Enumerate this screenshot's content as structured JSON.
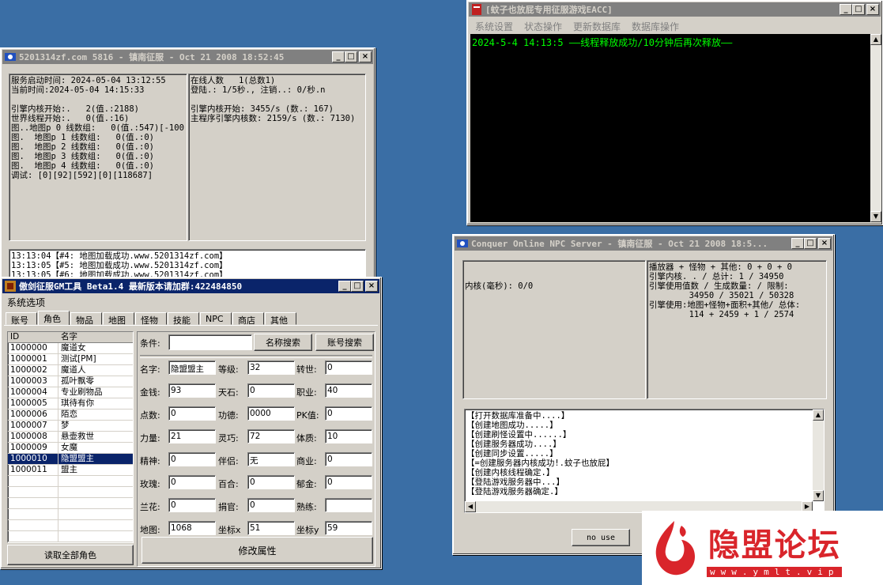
{
  "colors": {
    "desktop": "#3a6ea5",
    "title_active": "#0a246a",
    "title_inactive": "#808080",
    "console_text": "#00ff00",
    "watermark_red": "#d9252b"
  },
  "controls": {
    "minimize": "_",
    "maximize": "□",
    "close": "×"
  },
  "server": {
    "title": "5201314zf.com 5816 - 镇南征服 - Oct 21 2008 18:52:45",
    "left_lines": [
      "服务启动时间: 2024-05-04 13:12:55",
      "当前时间:2024-05-04 14:15:33",
      "",
      "引擎内核开始:.   2(值.:2188)",
      "世界线程开始:.   0(值.:16)",
      "图..地图p 0 线数组:   0(值.:547)[-100",
      "图.  地图p 1 线数组:   0(值.:0)",
      "图.  地图p 2 线数组:   0(值.:0)",
      "图.  地图p 3 线数组:   0(值.:0)",
      "图.  地图p 4 线数组:   0(值.:0)",
      "调试: [0][92][592][0][118687]"
    ],
    "right_lines": [
      "在线人数   1(总数1)",
      "登陆.: 1/5秒., 注销..: 0/秒.n",
      "",
      "引擎内核开始: 3455/s (数.: 167)",
      "主程序引擎内核数: 2159/s (数.: 7130)"
    ],
    "log_lines": [
      "13:13:04【#4: 地图加载成功.www.5201314zf.com】",
      "13:13:05【#5: 地图加载成功.www.5201314zf.com】",
      "13:13:05【#6: 地图加载成功.www.5201314zf.com】"
    ]
  },
  "eacc": {
    "title": "[蚊子也放屁专用征服游戏EACC]",
    "menu": [
      "系统设置",
      "状态操作",
      "更新数据库",
      "数据库操作"
    ],
    "console_line": "2024-5-4 14:13:5 ——线程释放成功/10分钟后再次释放——"
  },
  "npc": {
    "title": "Conquer Online NPC Server - 镇南征服 - Oct 21 2008 18:5...",
    "core_label": "内核(毫秒): 0/0",
    "right_lines": [
      "播放器 + 怪物 + 其他: 0 + 0 + 0",
      "引擎内核. . / 总计: 1 / 34950",
      "引擎使用值数 / 生成数量: / 限制:",
      "        34950 / 35021 / 50328",
      "引擎使用:地图+怪物+面积+其他/ 总体:",
      "        114 + 2459 + 1 / 2574"
    ],
    "log_lines": [
      "【打开数据库准备中....】",
      "【创建地图成功.....】",
      "【创建刷怪设置中......】",
      "【创建服务器成功....】",
      "【创建同步设置.....】",
      "【=创建服务器内核成功!.蚊子也放屁】",
      "【创建内核线程确定.】",
      "【登陆游戏服务器中...】",
      "【登陆游戏服务器确定.】"
    ],
    "no_use_button": "no use"
  },
  "gm": {
    "title": "傲剑征服GM工具 Beta1.4 最新版本请加群:422484850",
    "menu": "系统选项",
    "tabs": [
      "账号",
      "角色",
      "物品",
      "地图",
      "怪物",
      "技能",
      "NPC",
      "商店",
      "其他"
    ],
    "selected_tab": 1,
    "grid_headers": [
      "ID",
      "名字"
    ],
    "rows": [
      {
        "id": "1000000",
        "name": "魔道女"
      },
      {
        "id": "1000001",
        "name": "测试[PM]"
      },
      {
        "id": "1000002",
        "name": "魔道人"
      },
      {
        "id": "1000003",
        "name": "孤叶飘零"
      },
      {
        "id": "1000004",
        "name": "专业刷物品"
      },
      {
        "id": "1000005",
        "name": "琪待有你"
      },
      {
        "id": "1000006",
        "name": "陌恋"
      },
      {
        "id": "1000007",
        "name": "梦"
      },
      {
        "id": "1000008",
        "name": "悬壶救世"
      },
      {
        "id": "1000009",
        "name": "女魔"
      },
      {
        "id": "1000010",
        "name": "隐盟盟主"
      },
      {
        "id": "1000011",
        "name": "盟主"
      }
    ],
    "selected_row": 10,
    "read_all_button": "读取全部角色",
    "search_label": "条件:",
    "search_value": "",
    "name_search_button": "名称搜索",
    "account_search_button": "账号搜索",
    "fields": [
      [
        {
          "label": "名字:",
          "value": "隐盟盟主"
        },
        {
          "label": "等级:",
          "value": "32"
        },
        {
          "label": "转世:",
          "value": "0"
        }
      ],
      [
        {
          "label": "金钱:",
          "value": "93"
        },
        {
          "label": "天石:",
          "value": "0"
        },
        {
          "label": "职业:",
          "value": "40"
        }
      ],
      [
        {
          "label": "点数:",
          "value": "0"
        },
        {
          "label": "功德:",
          "value": "0000"
        },
        {
          "label": "PK值:",
          "value": "0"
        }
      ],
      [
        {
          "label": "力量:",
          "value": "21"
        },
        {
          "label": "灵巧:",
          "value": "72"
        },
        {
          "label": "体质:",
          "value": "10"
        }
      ],
      [
        {
          "label": "精神:",
          "value": "0"
        },
        {
          "label": "伴侣:",
          "value": "无"
        },
        {
          "label": "商业:",
          "value": "0"
        }
      ],
      [
        {
          "label": "玫瑰:",
          "value": "0"
        },
        {
          "label": "百合:",
          "value": "0"
        },
        {
          "label": "郁金:",
          "value": "0"
        }
      ],
      [
        {
          "label": "兰花:",
          "value": "0"
        },
        {
          "label": "捐官:",
          "value": "0"
        },
        {
          "label": "熟练:",
          "value": ""
        }
      ],
      [
        {
          "label": "地图:",
          "value": "1068"
        },
        {
          "label": "坐标x",
          "value": "51"
        },
        {
          "label": "坐标y",
          "value": "59"
        }
      ]
    ],
    "modify_button": "修改属性"
  },
  "watermark": {
    "title": "隐盟论坛",
    "url": "www.ymlt.vip"
  }
}
